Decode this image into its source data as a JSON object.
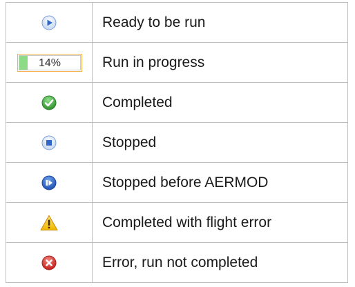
{
  "legend": {
    "rows": [
      {
        "icon": "play-circle-icon",
        "label": "Ready to be run"
      },
      {
        "icon": "progress-bar",
        "label": "Run in progress",
        "progress_text": "14%",
        "progress_fraction": 0.14
      },
      {
        "icon": "check-circle-icon",
        "label": "Completed"
      },
      {
        "icon": "stop-circle-icon",
        "label": "Stopped"
      },
      {
        "icon": "stop-play-circle-icon",
        "label": "Stopped before AERMOD"
      },
      {
        "icon": "warning-triangle-icon",
        "label": "Completed with flight error"
      },
      {
        "icon": "error-x-circle-icon",
        "label": "Error, run not completed"
      }
    ]
  },
  "colors": {
    "border": "#bfbfbf",
    "progress_fill": "#8ddb86",
    "progress_border": "#f5b04a",
    "play_blue": "#2f66c7",
    "check_green": "#3aa53a",
    "stop_blue": "#2f66c7",
    "warning_yellow": "#f3c623",
    "error_red": "#d9342b"
  }
}
